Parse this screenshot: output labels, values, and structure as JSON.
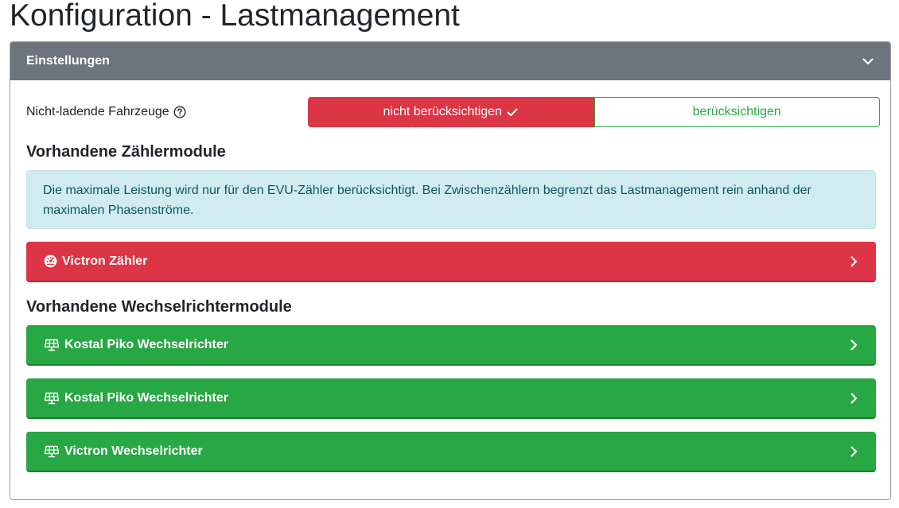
{
  "page": {
    "title": "Konfiguration - Lastmanagement"
  },
  "card": {
    "header_title": "Einstellungen",
    "toggle_icon": "chevron-down-icon"
  },
  "settings": {
    "nonloading_vehicles": {
      "label": "Nicht-ladende Fahrzeuge",
      "help_icon": "question-circle-icon",
      "options": [
        {
          "label": "nicht berücksichtigen",
          "selected": true,
          "icon": "check-icon"
        },
        {
          "label": "berücksichtigen",
          "selected": false
        }
      ]
    }
  },
  "meter_section": {
    "heading": "Vorhandene Zählermodule",
    "info_text": "Die maximale Leistung wird nur für den EVU-Zähler berücksichtigt. Bei Zwischenzählern begrenzt das Lastmanagement rein anhand der maximalen Phasenströme.",
    "modules": [
      {
        "label": "Victron Zähler",
        "icon": "tachometer-icon",
        "color": "#dc3545"
      }
    ]
  },
  "inverter_section": {
    "heading": "Vorhandene Wechselrichtermodule",
    "modules": [
      {
        "label": "Kostal Piko Wechselrichter",
        "icon": "solar-panel-icon",
        "color": "#28a745"
      },
      {
        "label": "Kostal Piko Wechselrichter",
        "icon": "solar-panel-icon",
        "color": "#28a745"
      },
      {
        "label": "Victron Wechselrichter",
        "icon": "solar-panel-icon",
        "color": "#28a745"
      }
    ]
  },
  "colors": {
    "header_bg": "#6c757d",
    "danger": "#dc3545",
    "success": "#28a745",
    "info_bg": "#d1ecf1",
    "info_text": "#0c5460"
  }
}
